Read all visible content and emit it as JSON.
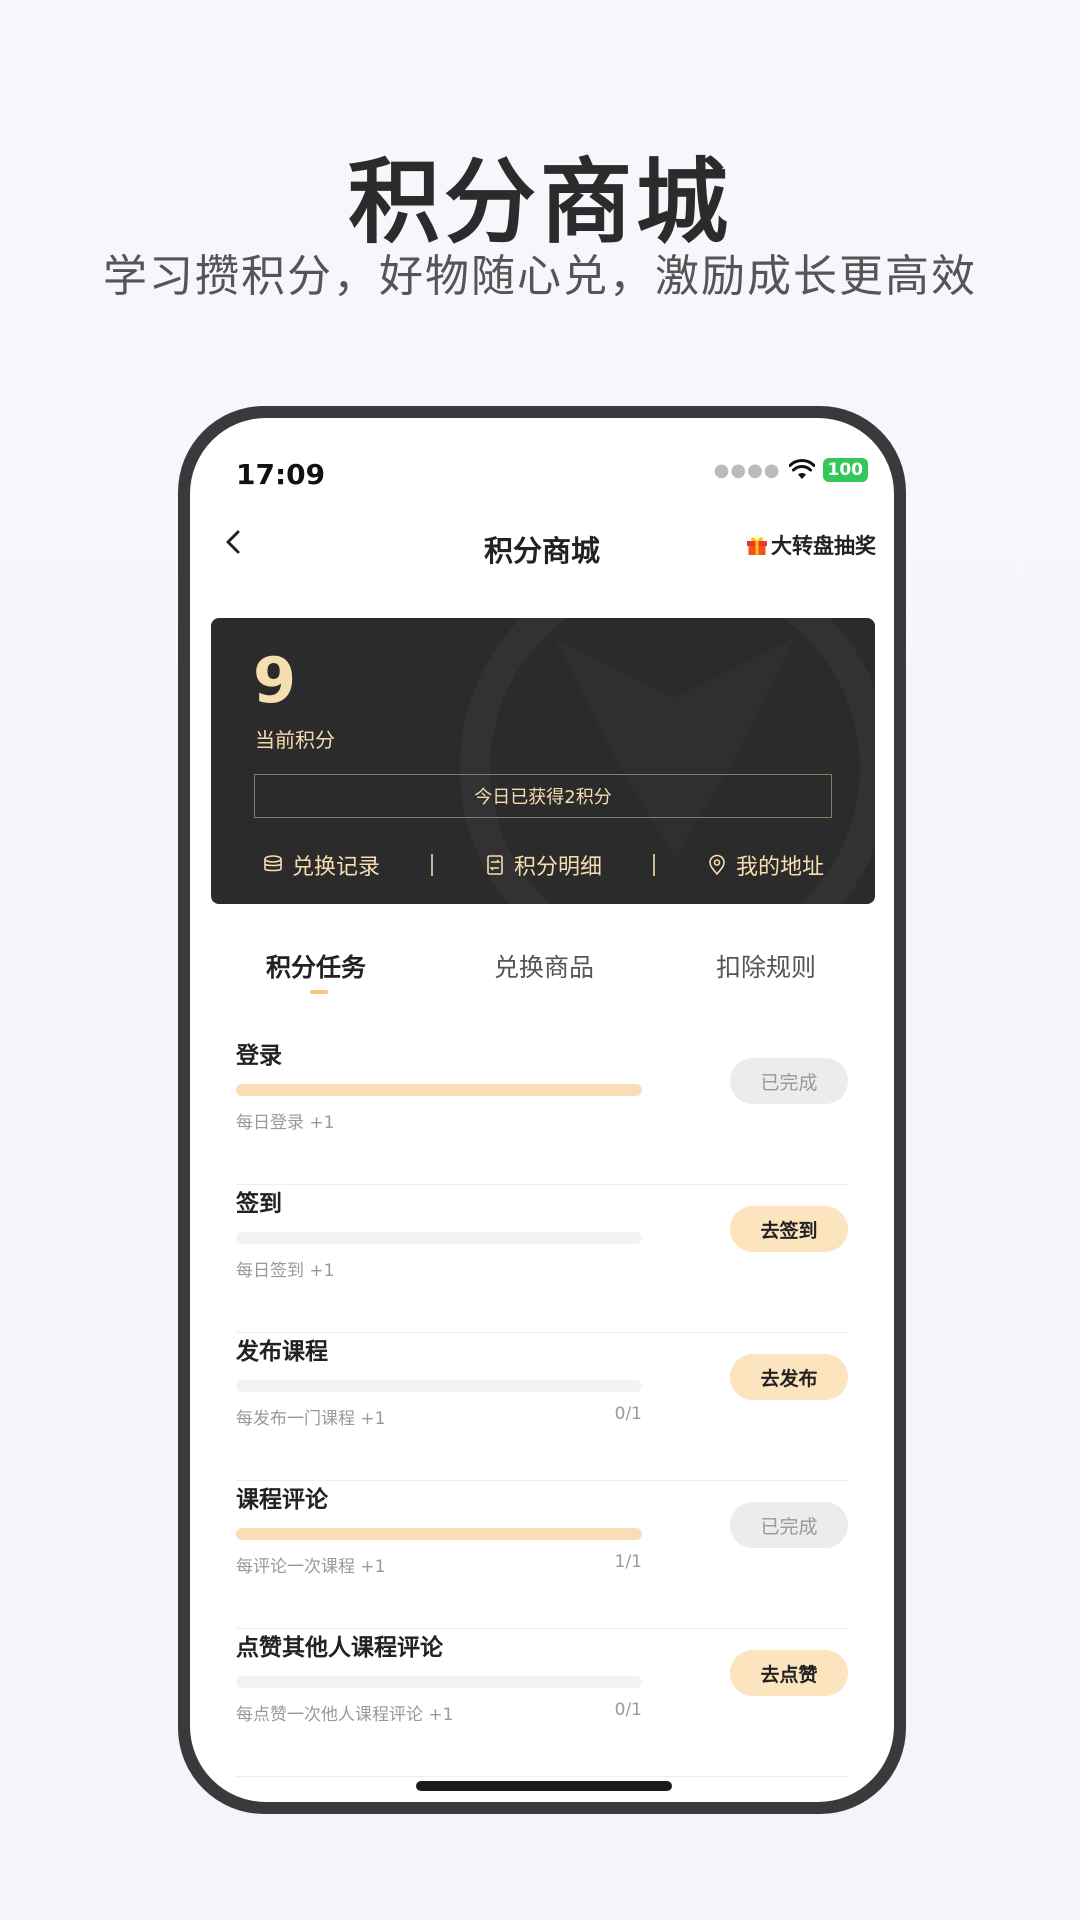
{
  "hero": {
    "title": "积分商城",
    "subtitle": "学习攒积分，好物随心兑，激励成长更高效"
  },
  "status_bar": {
    "time": "17:09",
    "battery": "100"
  },
  "nav": {
    "title": "积分商城",
    "right_label": "大转盘抽奖"
  },
  "points_card": {
    "value": "9",
    "label": "当前积分",
    "today_text": "今日已获得2积分",
    "links": [
      {
        "label": "兑换记录",
        "icon": "coins-icon"
      },
      {
        "label": "积分明细",
        "icon": "transfer-icon"
      },
      {
        "label": "我的地址",
        "icon": "location-pin-icon"
      }
    ]
  },
  "tabs": [
    {
      "label": "积分任务",
      "active": true
    },
    {
      "label": "兑换商品",
      "active": false
    },
    {
      "label": "扣除规则",
      "active": false
    }
  ],
  "tasks": [
    {
      "name": "登录",
      "desc": "每日登录 +1",
      "count": "",
      "progress": 1.0,
      "button": "已完成",
      "done": true
    },
    {
      "name": "签到",
      "desc": "每日签到 +1",
      "count": "",
      "progress": 0.0,
      "button": "去签到",
      "done": false
    },
    {
      "name": "发布课程",
      "desc": "每发布一门课程 +1",
      "count": "0/1",
      "progress": 0.0,
      "button": "去发布",
      "done": false
    },
    {
      "name": "课程评论",
      "desc": "每评论一次课程 +1",
      "count": "1/1",
      "progress": 1.0,
      "button": "已完成",
      "done": true
    },
    {
      "name": "点赞其他人课程评论",
      "desc": "每点赞一次他人课程评论 +1",
      "count": "0/1",
      "progress": 0.0,
      "button": "去点赞",
      "done": false
    }
  ],
  "colors": {
    "accent_gold": "#f5deb0",
    "button_go_bg": "#fbe4be",
    "button_done_bg": "#ececec",
    "card_bg": "#2b2b2b",
    "battery_green": "#34c759"
  }
}
